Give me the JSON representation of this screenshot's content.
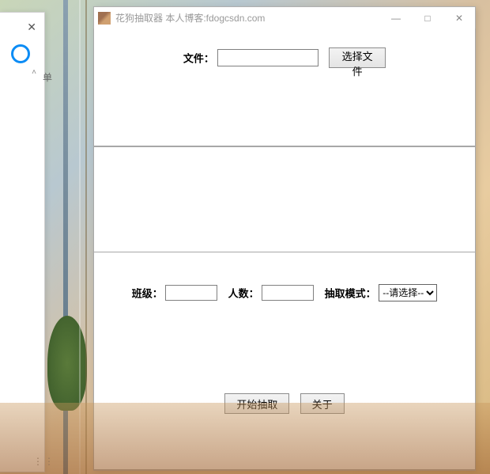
{
  "widget": {
    "close_glyph": "✕",
    "chev_glyph": "˄",
    "extra_text": "单",
    "dots": "⋮⋮"
  },
  "window": {
    "title": "花狗抽取器   本人博客:fdogcsdn.com",
    "min_glyph": "—",
    "max_glyph": "□",
    "close_glyph": "✕",
    "file_label": "文件：",
    "file_value": "",
    "choose_file_label": "选择文件",
    "class_label": "班级：",
    "class_value": "",
    "count_label": "人数：",
    "count_value": "",
    "mode_label": "抽取模式：",
    "mode_selected": "--请选择--",
    "mode_options": [
      "--请选择--"
    ],
    "start_label": "开始抽取",
    "about_label": "关于"
  }
}
